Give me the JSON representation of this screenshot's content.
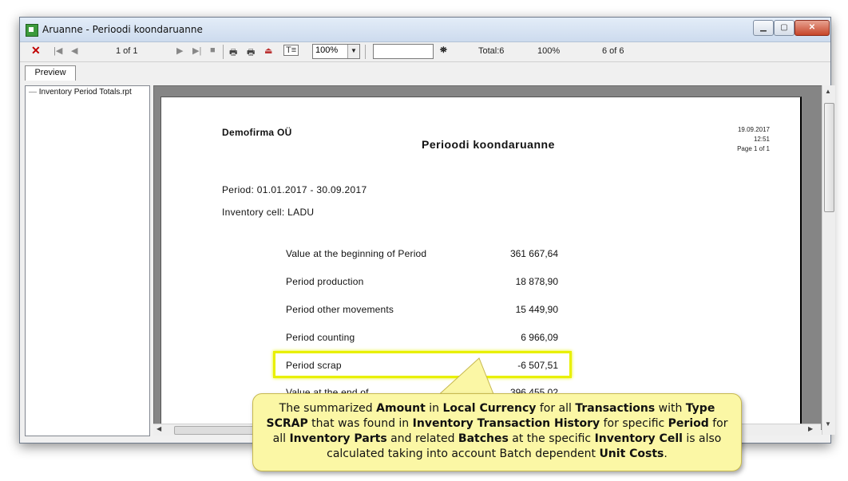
{
  "window": {
    "title": "Aruanne - Perioodi koondaruanne"
  },
  "toolbar": {
    "page_indicator": "1 of 1",
    "zoom": "100%",
    "total": "Total:6",
    "percent": "100%",
    "count": "6 of 6"
  },
  "tabs": [
    "Preview"
  ],
  "tree": {
    "item": "Inventory Period Totals.rpt"
  },
  "report": {
    "company": "Demofirma OÜ",
    "title": "Perioodi koondaruanne",
    "date": "19.09.2017",
    "time": "12:51",
    "page": "Page 1 of 1",
    "period": "Period: 01.01.2017 - 30.09.2017",
    "cell": "Inventory cell: LADU",
    "rows": [
      {
        "label": "Value at the beginning of Period",
        "value": "361 667,64"
      },
      {
        "label": "Period production",
        "value": "18 878,90"
      },
      {
        "label": "Period other movements",
        "value": "15 449,90"
      },
      {
        "label": "Period counting",
        "value": "6 966,09"
      },
      {
        "label": "Period scrap",
        "value": "-6 507,51"
      },
      {
        "label": "Value at the end of",
        "value": "396 455,02"
      }
    ]
  },
  "callout": {
    "s1": "The summarized ",
    "b1": "Amount",
    "s2": " in ",
    "b2": "Local Currency",
    "s3": " for all ",
    "b3": "Transactions",
    "s4": " with ",
    "b4": "Type SCRAP",
    "s5": " that was found in ",
    "b5": "Inventory Transaction History",
    "s6": " for specific ",
    "b6": "Period",
    "s7": " for all ",
    "b7": "Inventory Parts",
    "s8": " and related ",
    "b8": "Batches",
    "s9": " at the specific ",
    "b9": "Inventory Cell",
    "s10": " is also calculated taking into account Batch dependent ",
    "b10": "Unit Costs",
    "s11": "."
  },
  "colors": {
    "highlight": "#e8f000",
    "callout_bg": "#fbf7a5",
    "close_button": "#c6452a"
  }
}
